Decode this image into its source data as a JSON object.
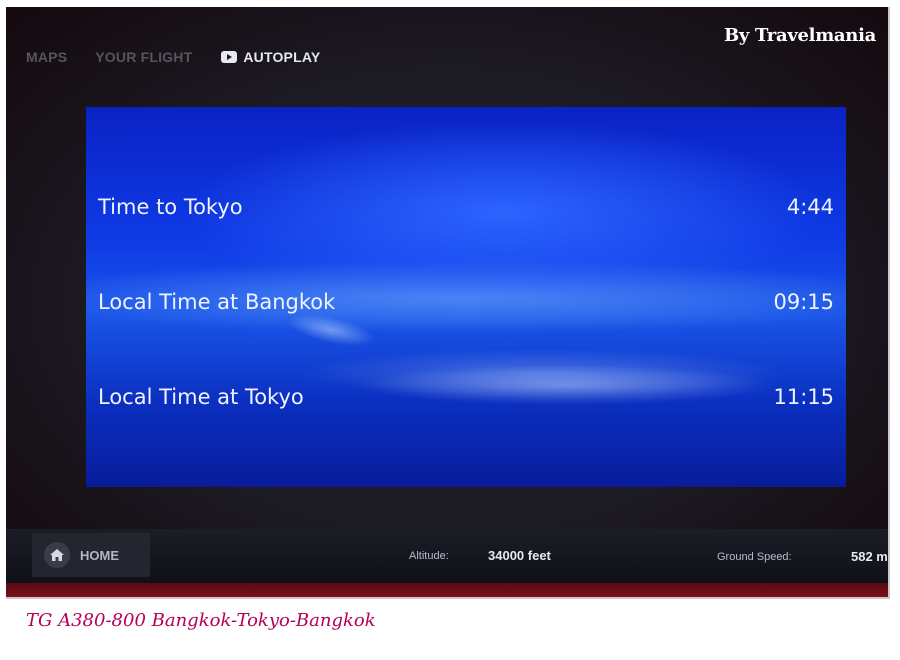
{
  "watermark": "By Travelmania",
  "nav": {
    "tabs": [
      {
        "label": "MAPS",
        "active": false
      },
      {
        "label": "YOUR FLIGHT",
        "active": false
      },
      {
        "label": "AUTOPLAY",
        "active": true,
        "icon": "autoplay-icon"
      }
    ]
  },
  "info": {
    "rows": [
      {
        "label": "Time to Tokyo",
        "value": "4:44"
      },
      {
        "label": "Local Time at Bangkok",
        "value": "09:15"
      },
      {
        "label": "Local Time at Tokyo",
        "value": "11:15"
      }
    ]
  },
  "footer": {
    "home_label": "HOME",
    "home_icon": "home-icon",
    "altitude_label": "Altitude:",
    "altitude_value": "34000 feet",
    "ground_speed_label": "Ground Speed:",
    "ground_speed_value": "582 m"
  },
  "caption": "TG A380-800 Bangkok-Tokyo-Bangkok",
  "colors": {
    "accent_blue": "#0f3be6",
    "caption_color": "#b40058",
    "bezel_red": "#7a0f19"
  }
}
